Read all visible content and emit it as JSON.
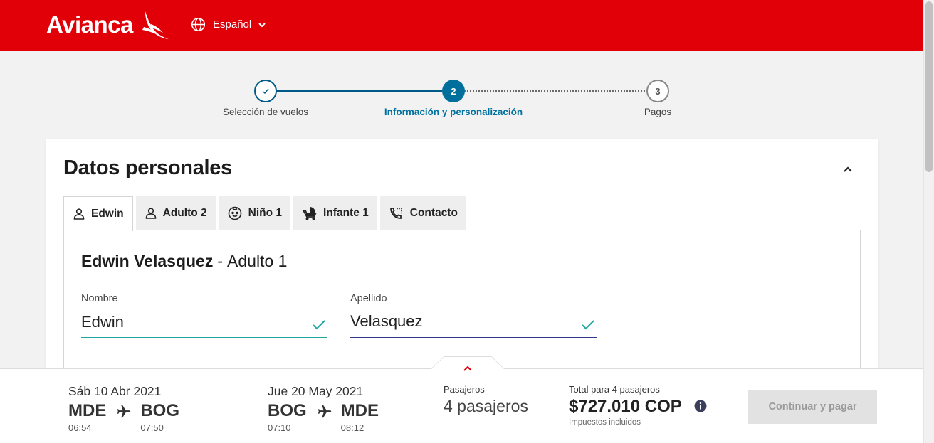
{
  "header": {
    "logo_text": "Avianca",
    "language": "Español",
    "brand_color": "#e10007"
  },
  "stepper": {
    "steps": [
      {
        "number": "1",
        "label": "Selección de vuelos",
        "state": "done"
      },
      {
        "number": "2",
        "label": "Información y personalización",
        "state": "current"
      },
      {
        "number": "3",
        "label": "Pagos",
        "state": "pending"
      }
    ]
  },
  "section": {
    "title": "Datos personales",
    "tabs": [
      {
        "label": "Edwin",
        "icon": "adult-icon"
      },
      {
        "label": "Adulto 2",
        "icon": "adult-icon"
      },
      {
        "label": "Niño 1",
        "icon": "child-face-icon"
      },
      {
        "label": "Infante 1",
        "icon": "stroller-icon"
      },
      {
        "label": "Contacto",
        "icon": "phone-icon"
      }
    ],
    "passenger": {
      "name": "Edwin Velasquez",
      "separator": "-",
      "type": "Adulto 1"
    },
    "fields": {
      "first_name": {
        "label": "Nombre",
        "value": "Edwin"
      },
      "last_name": {
        "label": "Apellido",
        "value": "Velasquez"
      }
    }
  },
  "summary": {
    "outbound": {
      "date": "Sáb 10 Abr 2021",
      "from": "MDE",
      "from_time": "06:54",
      "to": "BOG",
      "to_time": "07:50"
    },
    "return": {
      "date": "Jue 20 May 2021",
      "from": "BOG",
      "from_time": "07:10",
      "to": "MDE",
      "to_time": "08:12"
    },
    "passengers_label": "Pasajeros",
    "passengers_value": "4 pasajeros",
    "total_label": "Total para 4 pasajeros",
    "total_amount": "$727.010 COP",
    "taxes_note": "Impuestos incluidos",
    "continue_button": "Continuar y pagar"
  }
}
